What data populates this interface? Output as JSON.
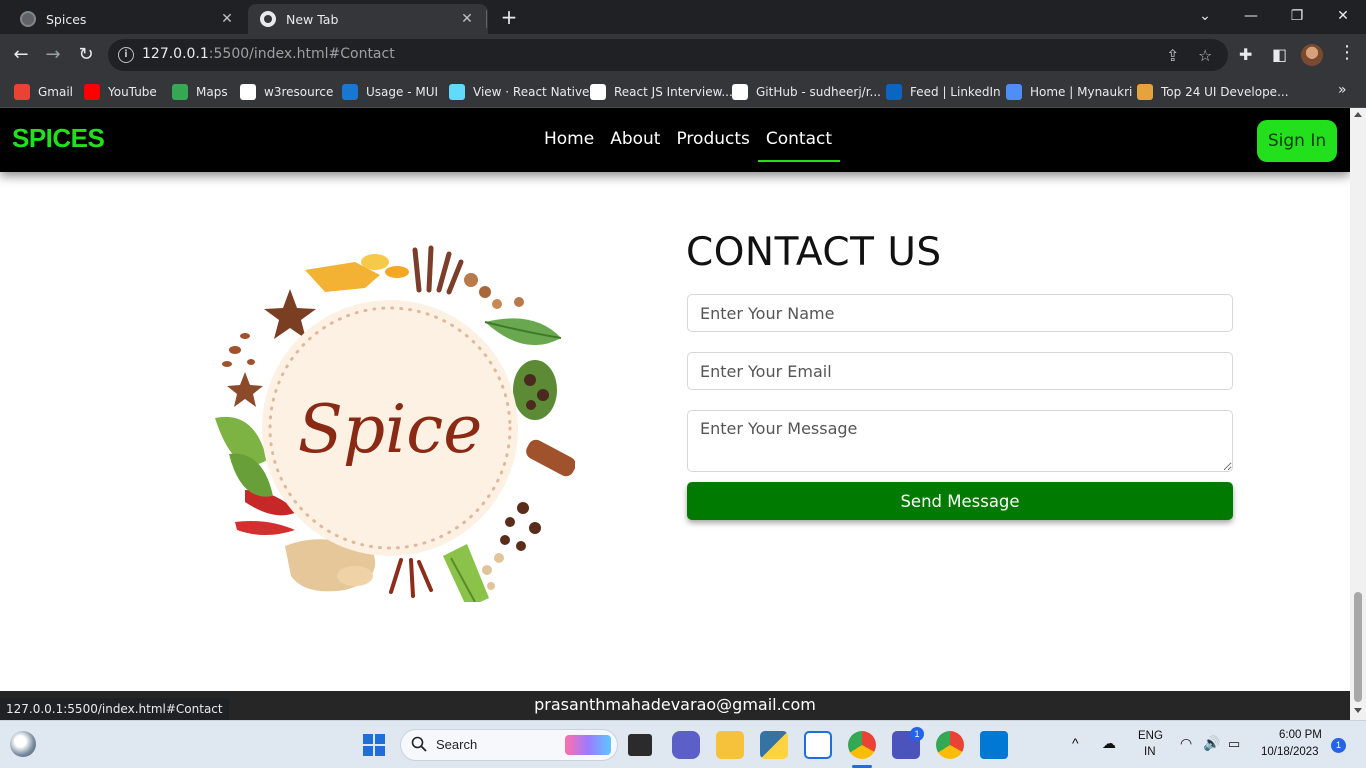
{
  "browser": {
    "tabs": [
      {
        "title": "Spices",
        "active": false
      },
      {
        "title": "New Tab",
        "active": true
      }
    ],
    "url_host": "127.0.0.1",
    "url_rest": ":5500/index.html#Contact",
    "bookmarks": [
      {
        "label": "Gmail",
        "icon": "gmail-icon",
        "color": "#ea4335"
      },
      {
        "label": "YouTube",
        "icon": "youtube-icon",
        "color": "#ff0000"
      },
      {
        "label": "Maps",
        "icon": "maps-icon",
        "color": "#34a853"
      },
      {
        "label": "w3resource",
        "icon": "w3resource-icon",
        "color": "#ffffff"
      },
      {
        "label": "Usage - MUI",
        "icon": "mui-icon",
        "color": "#1976d2"
      },
      {
        "label": "View · React Native",
        "icon": "react-icon",
        "color": "#61dafb"
      },
      {
        "label": "React JS Interview...",
        "icon": "google-icon",
        "color": "#ffffff"
      },
      {
        "label": "GitHub - sudheerj/r...",
        "icon": "github-icon",
        "color": "#ffffff"
      },
      {
        "label": "Feed | LinkedIn",
        "icon": "linkedin-icon",
        "color": "#0a66c2"
      },
      {
        "label": "Home | Mynaukri",
        "icon": "mynaukri-icon",
        "color": "#4f8ef7"
      },
      {
        "label": "Top 24 UI Develope...",
        "icon": "bookmark-icon",
        "color": "#e6a23c"
      }
    ],
    "status_url": "127.0.0.1:5500/index.html#Contact"
  },
  "site": {
    "brand": "SPICES",
    "nav": [
      "Home",
      "About",
      "Products",
      "Contact"
    ],
    "active_nav": "Contact",
    "signin": "Sign In",
    "accent_color": "#22e01b",
    "button_color": "#007a00"
  },
  "contact": {
    "heading": "CONTACT US",
    "name_placeholder": "Enter Your Name",
    "email_placeholder": "Enter Your Email",
    "message_placeholder": "Enter Your Message",
    "send_label": "Send Message"
  },
  "illustration": {
    "text": "Spice"
  },
  "footer": {
    "email": "prasanthmahadevarao@gmail.com"
  },
  "taskbar": {
    "search_label": "Search",
    "lang_top": "ENG",
    "lang_bottom": "IN",
    "time": "6:00 PM",
    "date": "10/18/2023",
    "notification_count": "1",
    "teams_badge": "1"
  }
}
